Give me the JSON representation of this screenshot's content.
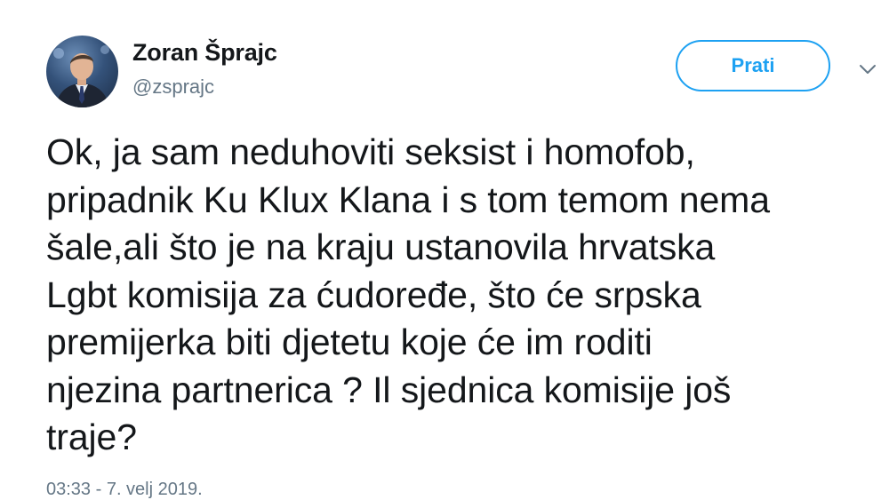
{
  "author": {
    "display_name": "Zoran Šprajc",
    "handle": "@zsprajc"
  },
  "follow_button": {
    "label": "Prati"
  },
  "more_menu": {
    "icon": "chevron-down-icon"
  },
  "tweet": {
    "text": "Ok, ja sam neduhoviti seksist i homofob,\npripadnik Ku Klux Klana i s tom temom nema\nšale,ali što je na kraju ustanovila hrvatska\nLgbt komisija za ćudoređe, što će srpska\npremijerka biti djetetu koje će im roditi\nnjezina partnerica ? Il sjednica komisije još\ntraje?",
    "timestamp": "03:33 - 7. velj 2019."
  },
  "colors": {
    "accent": "#1da1f2",
    "text": "#14171a",
    "muted": "#657786"
  }
}
